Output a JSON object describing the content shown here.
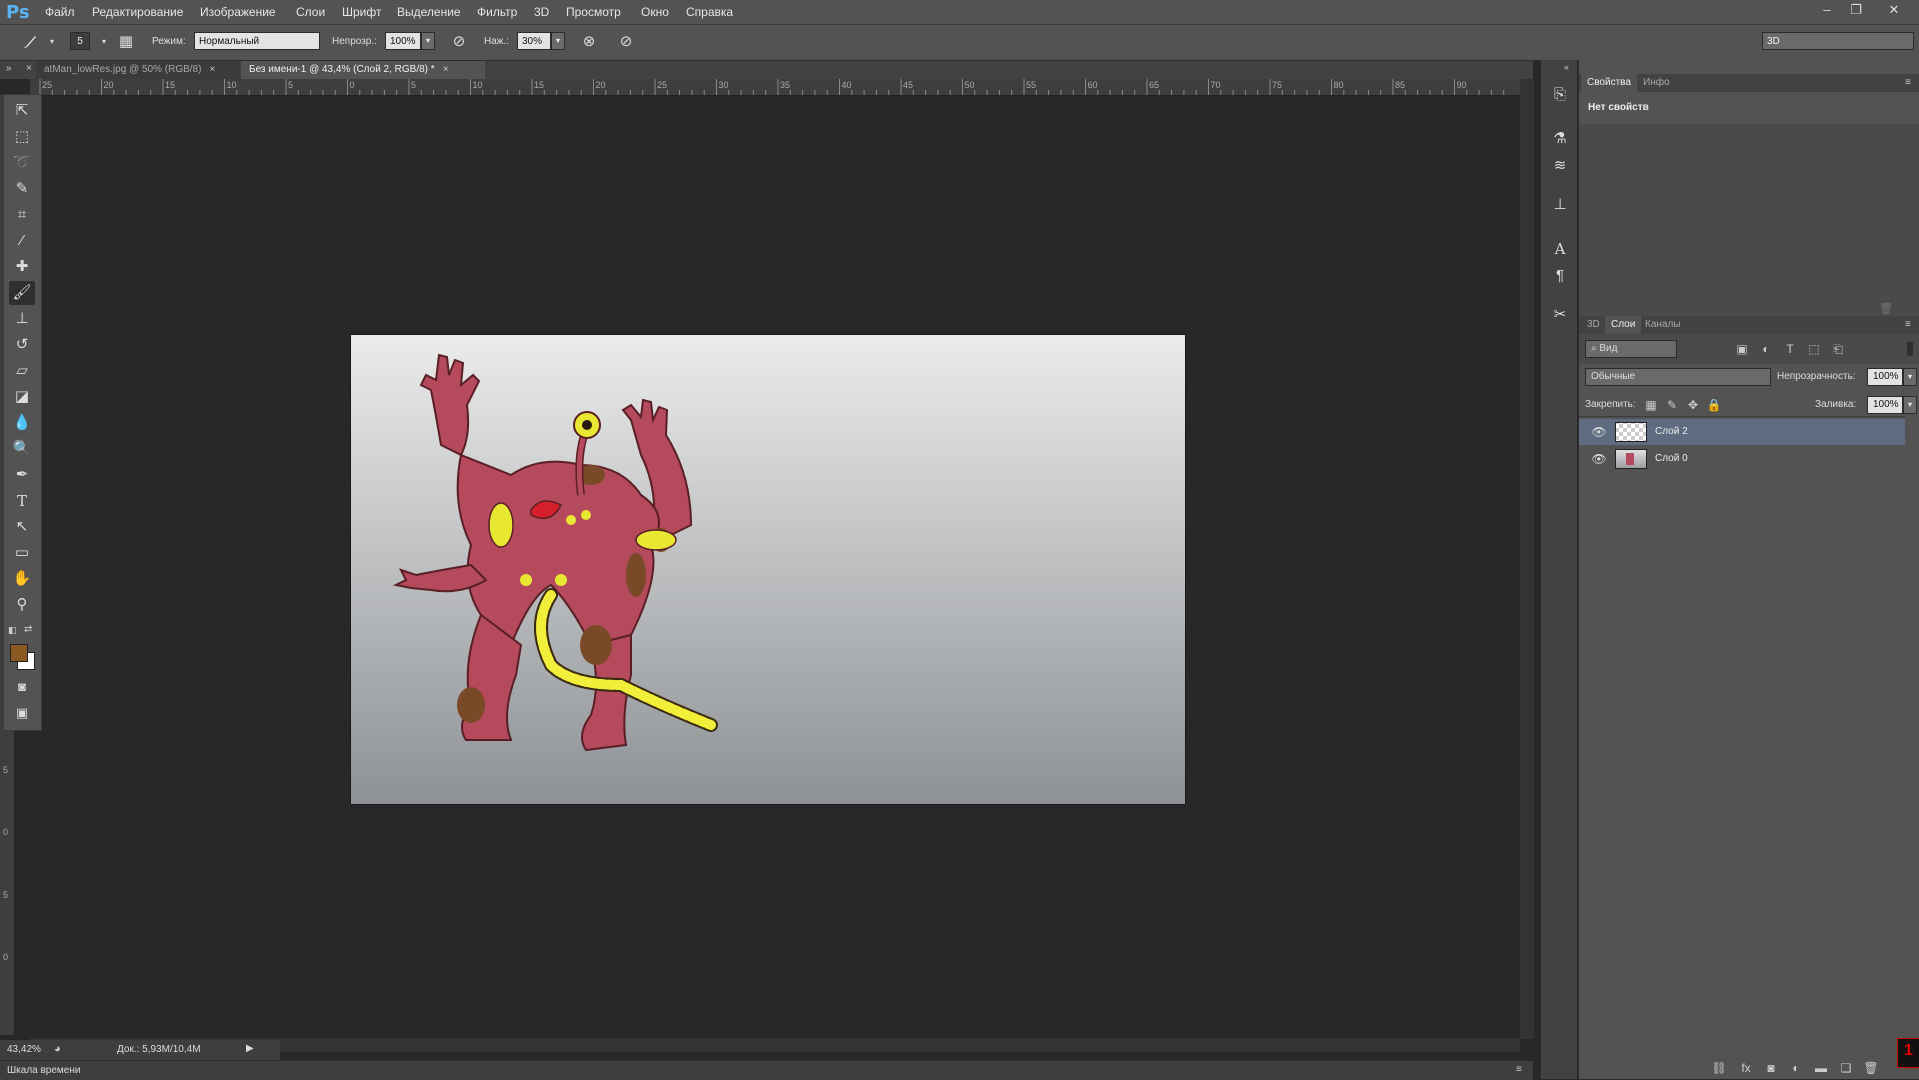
{
  "app": {
    "logo": "Ps"
  },
  "menu": [
    "Файл",
    "Редактирование",
    "Изображение",
    "Слои",
    "Шрифт",
    "Выделение",
    "Фильтр",
    "3D",
    "Просмотр",
    "Окно",
    "Справка"
  ],
  "window_controls": {
    "minimize": "–",
    "restore": "❐",
    "close": "✕"
  },
  "options": {
    "brush_size": "5",
    "mode_label": "Режим:",
    "mode_value": "Нормальный",
    "opacity_label": "Непрозр.:",
    "opacity_value": "100%",
    "pressure_label": "Наж.:",
    "pressure_value": "30%",
    "workspace": "3D"
  },
  "tabs": [
    {
      "label": "atMan_lowRes.jpg @ 50% (RGB/8)",
      "close": "×"
    },
    {
      "label": "Без имени-1 @ 43,4% (Слой 2, RGB/8) *",
      "close": "×"
    }
  ],
  "ruler_top_labels": [
    "25",
    "20",
    "15",
    "10",
    "5",
    "0",
    "5",
    "10",
    "15",
    "20",
    "25",
    "30",
    "35",
    "40",
    "45",
    "50",
    "55",
    "60",
    "65",
    "70",
    "75",
    "80",
    "85",
    "90"
  ],
  "ruler_left_labels": [
    "5",
    "0",
    "5",
    "0"
  ],
  "tools": [
    "move-icon",
    "marquee-icon",
    "lasso-icon",
    "quick-select-icon",
    "crop-icon",
    "eyedropper-icon",
    "healing-icon",
    "brush-icon",
    "stamp-icon",
    "history-brush-icon",
    "eraser-icon",
    "paint-bucket-icon",
    "blur-icon",
    "dodge-icon",
    "pen-icon",
    "type-icon",
    "path-select-icon",
    "rectangle-icon",
    "hand-icon",
    "zoom-icon"
  ],
  "colors": {
    "foreground": "#8a5a22",
    "background": "#ffffff",
    "selected_layer": "#5e6b80"
  },
  "status": {
    "zoom": "43,42%",
    "doc": "Док.: 5,93M/10,4M"
  },
  "timeline": {
    "label": "Шкала времени"
  },
  "properties_panel": {
    "tabs": [
      "Свойства",
      "Инфо"
    ],
    "content": "Нет свойств"
  },
  "layers_panel": {
    "tabs": [
      "3D",
      "Слои",
      "Каналы"
    ],
    "filter": "Вид",
    "blend_mode": "Обычные",
    "opacity_label": "Непрозрачность:",
    "opacity_value": "100%",
    "lock_label": "Закрепить:",
    "fill_label": "Заливка:",
    "fill_value": "100%",
    "layers": [
      {
        "name": "Слой 2",
        "selected": true
      },
      {
        "name": "Слой 0",
        "selected": false
      }
    ]
  }
}
